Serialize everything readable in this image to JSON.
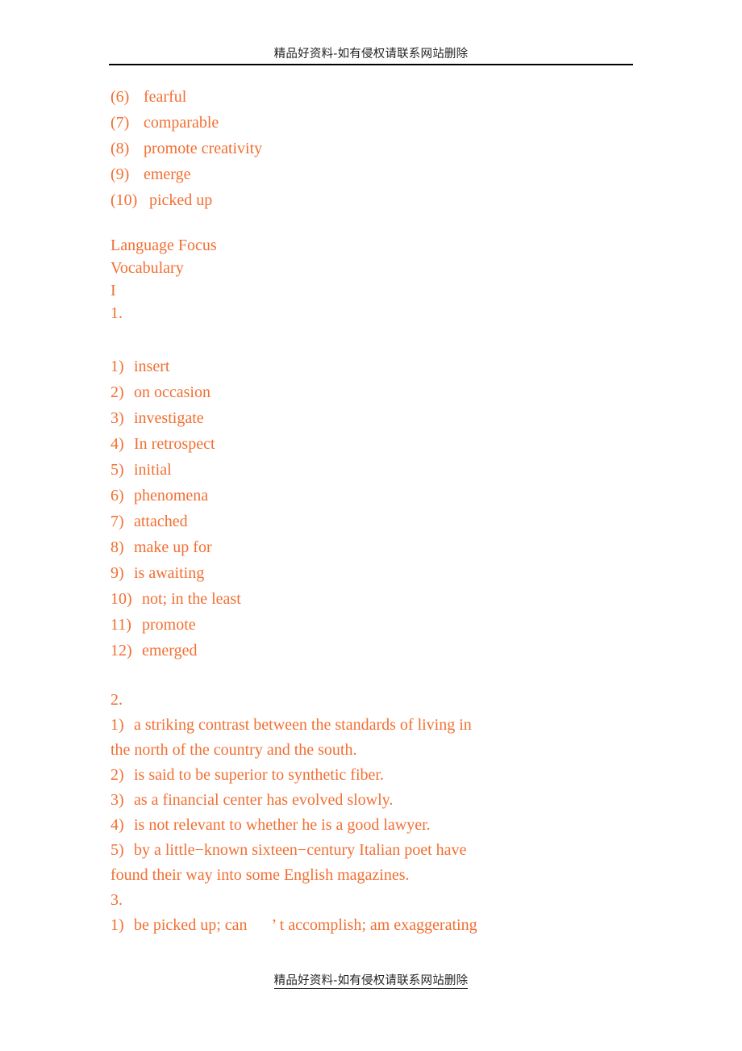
{
  "page": {
    "background_color": "#ffffff",
    "text_color": "#f26f33",
    "header_footer_color": "#231f20"
  },
  "header": {
    "watermark": "精品好资料-如有侵权请联系网站删除"
  },
  "footer": {
    "watermark": "精品好资料-如有侵权请联系网站删除"
  },
  "content": {
    "continued_list": {
      "items": [
        {
          "marker": "(6)",
          "text": "fearful"
        },
        {
          "marker": "(7)",
          "text": "comparable"
        },
        {
          "marker": "(8)",
          "text": "promote creativity"
        },
        {
          "marker": "(9)",
          "text": "emerge"
        },
        {
          "marker": "(10)",
          "text": "picked up"
        }
      ]
    },
    "section_heading": {
      "title": "Language Focus",
      "subtitle": "Vocabulary",
      "part": "I",
      "exercise": "1."
    },
    "vocabulary_list": {
      "items": [
        {
          "marker": "1)",
          "text": "insert"
        },
        {
          "marker": "2)",
          "text": "on occasion"
        },
        {
          "marker": "3)",
          "text": "investigate"
        },
        {
          "marker": "4)",
          "text": "In retrospect"
        },
        {
          "marker": "5)",
          "text": "initial"
        },
        {
          "marker": "6)",
          "text": "phenomena"
        },
        {
          "marker": "7)",
          "text": "attached"
        },
        {
          "marker": "8)",
          "text": "make up for"
        },
        {
          "marker": "9)",
          "text": "is awaiting"
        },
        {
          "marker": "10)",
          "text": "not; in the least"
        },
        {
          "marker": "11)",
          "text": "promote"
        },
        {
          "marker": "12)",
          "text": "emerged"
        }
      ]
    },
    "exercise_2": {
      "number": "2.",
      "items": [
        {
          "marker": "1)",
          "line1": "a striking contrast between the standards of living in",
          "line2": "the north of the country and the south."
        },
        {
          "marker": "2)",
          "line1": "is said to be superior to synthetic fiber.",
          "line2": ""
        },
        {
          "marker": "3)",
          "line1": "as a financial center has evolved slowly.",
          "line2": ""
        },
        {
          "marker": "4)",
          "line1": "is not relevant to whether he is a good lawyer.",
          "line2": ""
        },
        {
          "marker": "5)",
          "line1": "by a little−known sixteen−century Italian poet have",
          "line2": "found their way into some English magazines."
        }
      ]
    },
    "exercise_3": {
      "number": "3.",
      "items": [
        {
          "marker": "1)",
          "text": "be picked up; can      ’ t accomplish; am exaggerating"
        }
      ]
    }
  }
}
